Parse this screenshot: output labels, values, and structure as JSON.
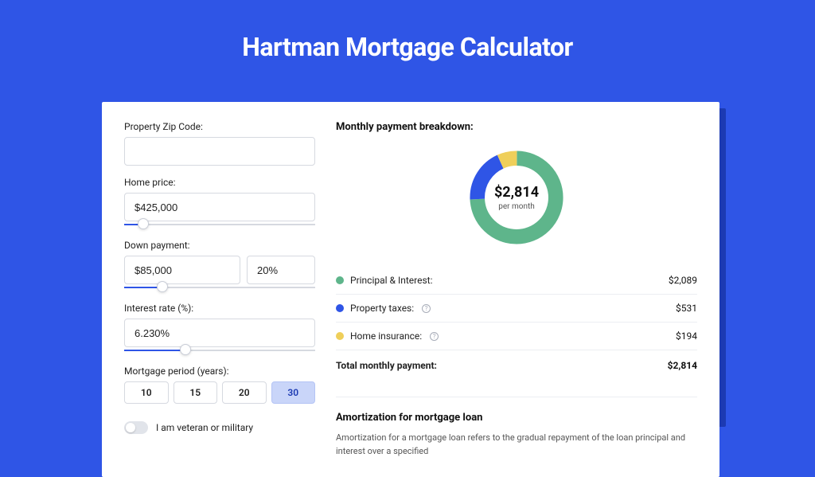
{
  "title": "Hartman Mortgage Calculator",
  "form": {
    "zip_label": "Property Zip Code:",
    "zip_value": "",
    "home_price_label": "Home price:",
    "home_price_value": "$425,000",
    "home_price_slider_pct": 10,
    "down_label": "Down payment:",
    "down_value": "$85,000",
    "down_pct": "20%",
    "down_slider_pct": 20,
    "rate_label": "Interest rate (%):",
    "rate_value": "6.230%",
    "rate_slider_pct": 32,
    "period_label": "Mortgage period (years):",
    "period_options": [
      "10",
      "15",
      "20",
      "30"
    ],
    "period_selected": "30",
    "veteran_label": "I am veteran or military",
    "veteran_on": false
  },
  "breakdown": {
    "title": "Monthly payment breakdown:",
    "center_amount": "$2,814",
    "center_sub": "per month",
    "items": [
      {
        "label": "Principal & Interest:",
        "value": "$2,089",
        "color": "#5eb58b",
        "info": false
      },
      {
        "label": "Property taxes:",
        "value": "$531",
        "color": "#2f55e6",
        "info": true
      },
      {
        "label": "Home insurance:",
        "value": "$194",
        "color": "#efcf5a",
        "info": true
      }
    ],
    "total_label": "Total monthly payment:",
    "total_value": "$2,814"
  },
  "chart_data": {
    "type": "pie",
    "title": "Monthly payment breakdown",
    "series": [
      {
        "name": "Principal & Interest",
        "value": 2089,
        "color": "#5eb58b"
      },
      {
        "name": "Property taxes",
        "value": 531,
        "color": "#2f55e6"
      },
      {
        "name": "Home insurance",
        "value": 194,
        "color": "#efcf5a"
      }
    ],
    "total": 2814,
    "donut": true
  },
  "amort": {
    "title": "Amortization for mortgage loan",
    "text": "Amortization for a mortgage loan refers to the gradual repayment of the loan principal and interest over a specified"
  }
}
